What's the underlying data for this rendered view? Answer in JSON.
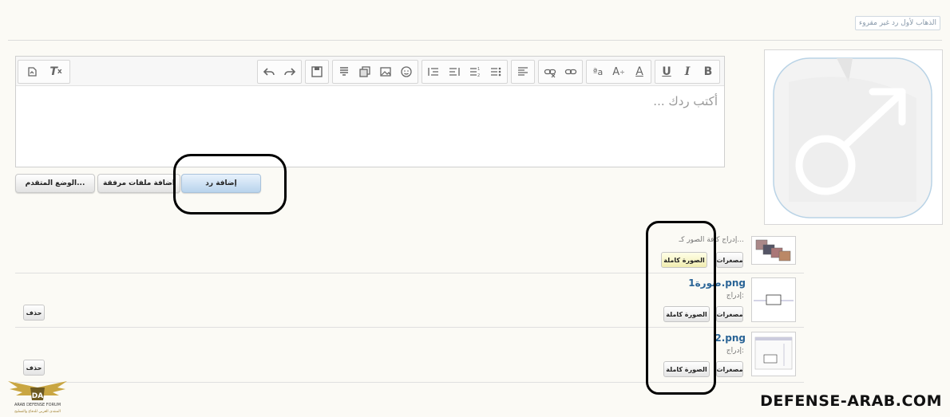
{
  "top_link": "الذهاب لأول رد غير مقروء",
  "editor": {
    "placeholder": "أكتب ردك ..."
  },
  "buttons": {
    "advanced": "الوضع المتقدم...",
    "attach": "اضافة ملفات مرفقة",
    "reply": "إضافة رد"
  },
  "attachments": {
    "insert_all_label": "إدراج كافة الصور كـ...",
    "thumbs_label": "مصغرات",
    "full_label": "الصورة كاملة",
    "delete_label": "حذف",
    "insert_label": "إدراج:",
    "items": [
      {
        "name": "صورة1.png"
      },
      {
        "name": "2.png"
      }
    ]
  },
  "watermark": "DEFENSE-ARAB.COM",
  "logo": {
    "abbr": "DA",
    "line1": "ARAB DEFENSE FORUM",
    "line2": "المنتدى العربي للدفاع والتسليح"
  }
}
